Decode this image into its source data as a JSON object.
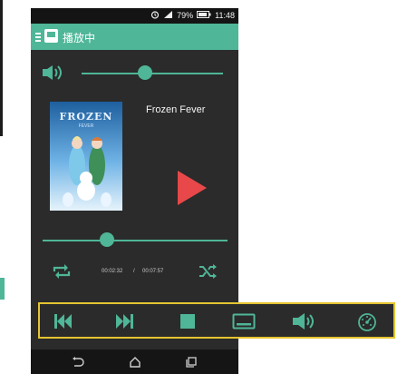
{
  "status": {
    "battery_percent": "79%",
    "time": "11:48"
  },
  "appbar": {
    "title": "播放中"
  },
  "player": {
    "volume_level": 0.45,
    "song_title": "Frozen Fever",
    "poster_title": "FROZEN",
    "poster_subtitle": "FEVER",
    "seek_position": 0.35,
    "elapsed": "00:02:32",
    "separator": "/",
    "duration": "00:07:57"
  },
  "colors": {
    "accent": "#4fb697",
    "play": "#e8484a",
    "toolbar_border": "#e5c430"
  },
  "toolbar": {
    "icons": [
      "skip-previous-icon",
      "skip-next-icon",
      "stop-icon",
      "subtitle-icon",
      "volume-icon",
      "speed-dial-icon"
    ]
  }
}
